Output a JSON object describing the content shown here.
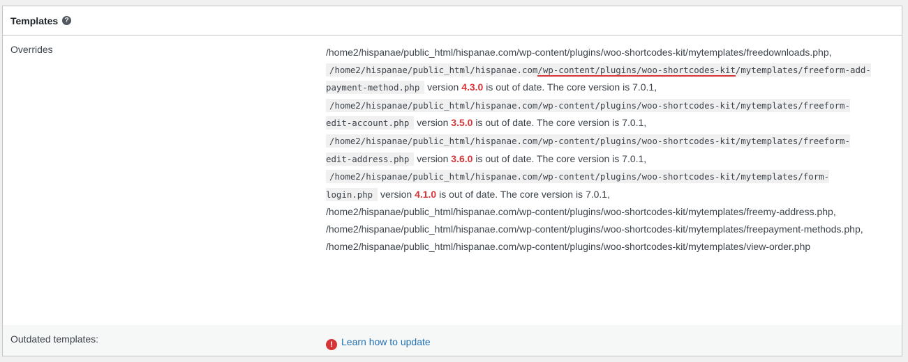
{
  "table": {
    "title": "Templates",
    "help_icon": "question-circle-icon"
  },
  "overrides": {
    "label": "Overrides",
    "plain_1": "/home2/hispanae/public_html/hispanae.com/wp-content/plugins/woo-shortcodes-kit/mytemplates/freedownloads.php,",
    "outdated": [
      {
        "path_pre": "/home2/hispanae/public_html/hispanae.com",
        "path_ul1": "/wp-content/plugins/woo-shortcodes-",
        "path_ul2": "kit",
        "path_post": "/mytemplates/freeform-add-payment-method.php",
        "version_word": "version",
        "version": "4.3.0",
        "suffix": "is out of date. The core version is 7.0.1,"
      },
      {
        "path": "/home2/hispanae/public_html/hispanae.com/wp-content/plugins/woo-shortcodes-kit/mytemplates/freeform-edit-account.php",
        "version_word": "version",
        "version": "3.5.0",
        "suffix": "is out of date. The core version is 7.0.1,"
      },
      {
        "path": "/home2/hispanae/public_html/hispanae.com/wp-content/plugins/woo-shortcodes-kit/mytemplates/freeform-edit-address.php",
        "version_word": "version",
        "version": "3.6.0",
        "suffix": "is out of date. The core version is 7.0.1,"
      },
      {
        "path": "/home2/hispanae/public_html/hispanae.com/wp-content/plugins/woo-shortcodes-kit/mytemplates/form-login.php",
        "version_word": "version",
        "version": "4.1.0",
        "suffix": "is out of date. The core version is 7.0.1,"
      }
    ],
    "plain_2": "/home2/hispanae/public_html/hispanae.com/wp-content/plugins/woo-shortcodes-kit/mytemplates/freemy-address.php,",
    "plain_3": "/home2/hispanae/public_html/hispanae.com/wp-content/plugins/woo-shortcodes-kit/mytemplates/freepayment-methods.php,",
    "plain_4": "/home2/hispanae/public_html/hispanae.com/wp-content/plugins/woo-shortcodes-kit/mytemplates/view-order.php"
  },
  "outdated_templates": {
    "label": "Outdated templates:",
    "icon": "exclamation-circle-icon",
    "link_text": "Learn how to update"
  },
  "colors": {
    "version": "#d63638",
    "link": "#2271b1"
  }
}
